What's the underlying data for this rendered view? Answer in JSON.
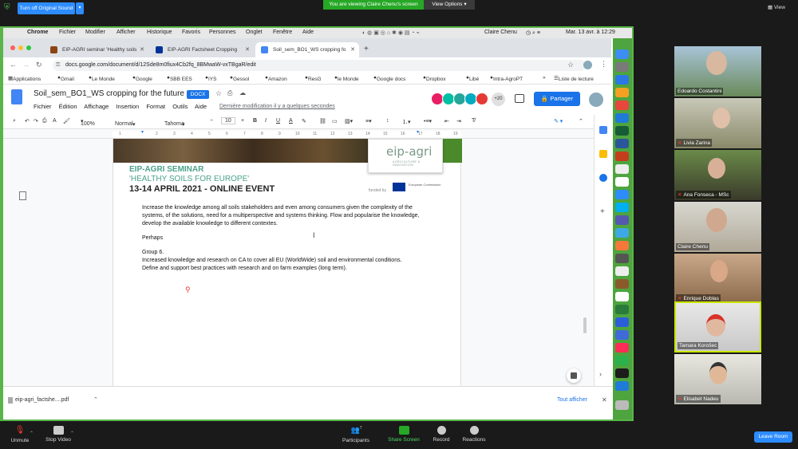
{
  "zoom": {
    "sound_button": "Turn off Original Sound",
    "viewing_banner": "You are viewing Claire Chenu's screen",
    "view_options": "View Options",
    "view_toggle": "View",
    "unmute": "Unmute",
    "stop_video": "Stop Video",
    "participants": "Participants",
    "participants_count": "7",
    "share_screen": "Share Screen",
    "record": "Record",
    "reactions": "Reactions",
    "leave": "Leave Room"
  },
  "menubar": {
    "app": "Chrome",
    "items": [
      "Fichier",
      "Modifier",
      "Afficher",
      "Historique",
      "Favoris",
      "Personnes",
      "Onglet",
      "Fenêtre",
      "Aide"
    ],
    "user": "Claire Chenu",
    "clock": "Mar. 13 avr. à 12:29"
  },
  "browser": {
    "tabs": [
      {
        "label": "EIP-AGRI seminar 'Healthy soils",
        "color": "#8b4513"
      },
      {
        "label": "EIP-AGRI Factsheet Cropping",
        "color": "#003399"
      },
      {
        "label": "Soil_sem_BO1_WS cropping fo",
        "color": "#4285f4"
      }
    ],
    "url": "docs.google.com/document/d/12Sde8m0fiux4Cb2fq_8BMwaW-vxTBgaR/edit",
    "bookmarks": [
      "Applications",
      "Gmail",
      "Le Monde",
      "Google",
      "SBB EES",
      "IYS",
      "Gessol",
      "Amazon",
      "ResG",
      "le Monde",
      "Google docs",
      "Dropbox",
      "Libé",
      "Intra-AgroPT"
    ],
    "bookmarks_more": "»",
    "reading_list": "Liste de lecture"
  },
  "docs": {
    "title": "Soil_sem_BO1_WS cropping for the future",
    "badge": "DOCX",
    "menu": [
      "Fichier",
      "Édition",
      "Affichage",
      "Insertion",
      "Format",
      "Outils",
      "Aide"
    ],
    "last_edit": "Dernière modification il y a quelques secondes",
    "share": "Partager",
    "more_collaborators": "+20",
    "toolbar": {
      "zoom": "100%",
      "style": "Normal",
      "font": "Tahoma",
      "size": "10"
    },
    "ruler_numbers": [
      "1",
      "2",
      "3",
      "4",
      "5",
      "6",
      "7",
      "8",
      "9",
      "10",
      "11",
      "12",
      "13",
      "14",
      "15",
      "16",
      "17",
      "18",
      "19"
    ],
    "banner": {
      "logo": "eip-agri",
      "logo_sub": "AGRICULTURE & INNOVATION",
      "line1": "EIP-AGRI SEMINAR",
      "line2": "'HEALTHY SOILS FOR EUROPE'",
      "line3": "13-14 APRIL 2021 - ONLINE EVENT",
      "funded": "funded by",
      "eu": "European Commission"
    },
    "body": {
      "p1": "Increase the knowledge among all soils stakeholders and even among consumers given the complexity of the systems, of the solutions, need for a multiperspective and systems thinking. Flow and popularise the knowledge, develop the available knowledge to different contextes.",
      "p2": "Perhaps",
      "p3": "Group 6.",
      "p4": "Increased knowledge and research on CA to cover all EU (WorldWide) soil and environmental conditions.",
      "p5": "Define and support best practices with research and on farm examples (long term)."
    }
  },
  "downloads": {
    "file": "eip-agri_factshe....pdf",
    "show_all": "Tout afficher"
  },
  "participants": [
    {
      "name": "Edoardo Costantini",
      "muted": false
    },
    {
      "name": "Livia Zarina",
      "muted": true
    },
    {
      "name": "Ana Fonseca - MSc",
      "muted": true
    },
    {
      "name": "Claire Chenu",
      "muted": false
    },
    {
      "name": "Enrique Doblas",
      "muted": true
    },
    {
      "name": "Tamara Korošec",
      "muted": false
    },
    {
      "name": "Elisabet Nadeu",
      "muted": true
    }
  ],
  "colors": {
    "zoom_blue": "#2d8cff",
    "share_green": "#26a826",
    "docs_blue": "#1a73e8",
    "speaker_border": "#c8e600"
  }
}
